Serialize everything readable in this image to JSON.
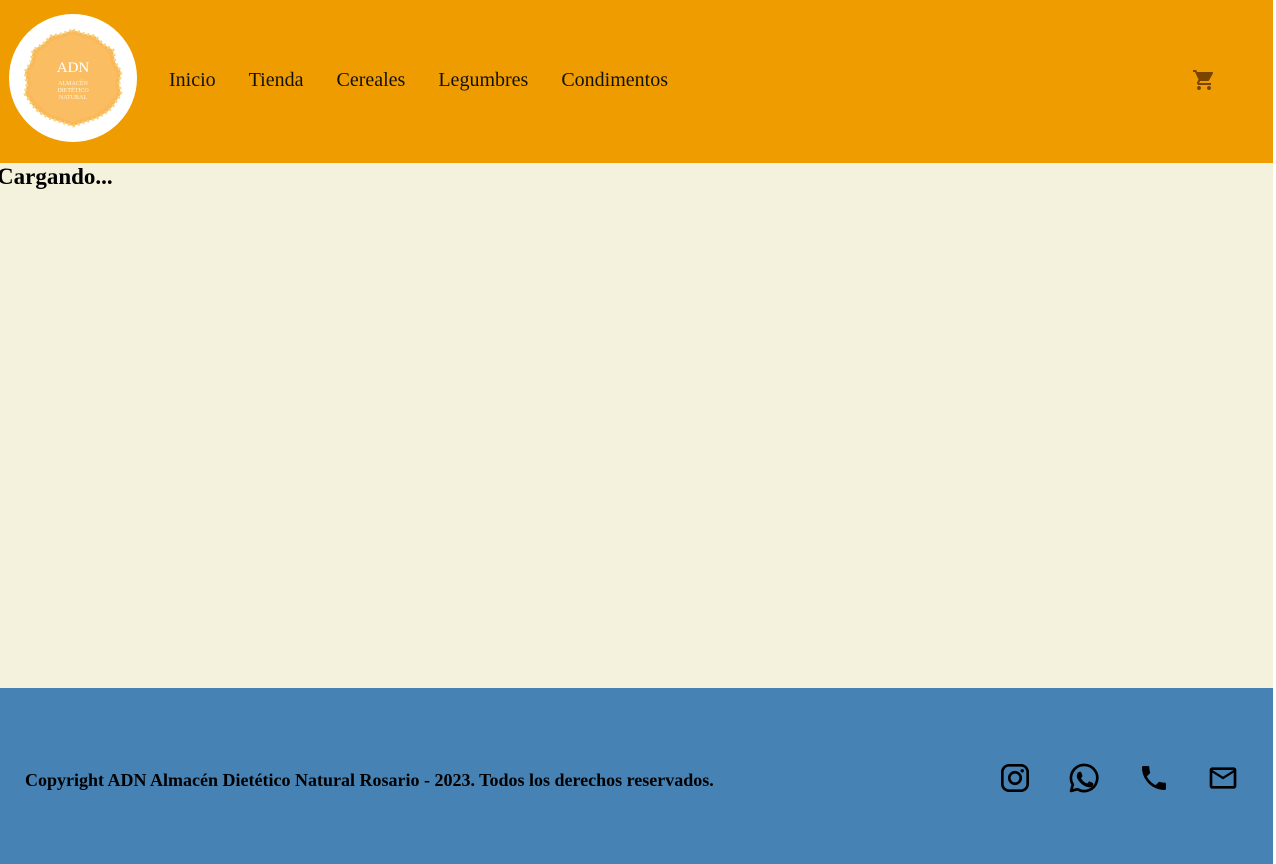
{
  "header": {
    "logo": {
      "title": "ADN",
      "line1": "ALMACÉN",
      "line2": "DIETÉTICO",
      "line3": "NATURAL"
    },
    "nav": [
      {
        "label": "Inicio"
      },
      {
        "label": "Tienda"
      },
      {
        "label": "Cereales"
      },
      {
        "label": "Legumbres"
      },
      {
        "label": "Condimentos"
      }
    ],
    "cart_icon": "shopping-cart-icon"
  },
  "main": {
    "loading_text": "Cargando..."
  },
  "footer": {
    "copyright": "Copyright ADN Almacén Dietético Natural Rosario - 2023. Todos los derechos reservados.",
    "social_icons": [
      "instagram-icon",
      "whatsapp-icon",
      "phone-icon",
      "mail-icon"
    ]
  },
  "colors": {
    "header_bg": "#ef9c00",
    "body_bg": "#f4f2dc",
    "footer_bg": "#4682b4",
    "logo_badge": "#f9b95a",
    "cart_icon": "#7a4300"
  }
}
